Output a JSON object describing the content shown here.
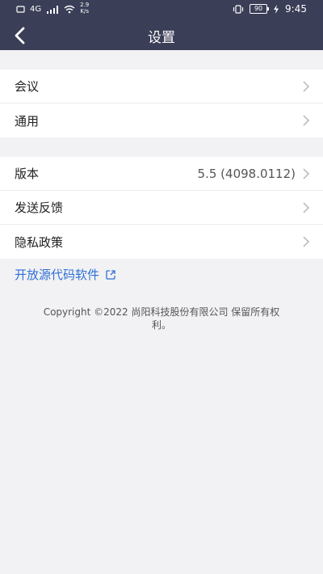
{
  "status_bar": {
    "network_label": "4G",
    "speed_top": "2.9",
    "speed_bottom": "K/s",
    "battery": "90",
    "time": "9:45"
  },
  "header": {
    "title": "设置"
  },
  "groups": [
    {
      "items": [
        {
          "label": "会议",
          "value": ""
        },
        {
          "label": "通用",
          "value": ""
        }
      ]
    },
    {
      "items": [
        {
          "label": "版本",
          "value": "5.5 (4098.0112)"
        },
        {
          "label": "发送反馈",
          "value": ""
        },
        {
          "label": "隐私政策",
          "value": ""
        }
      ]
    }
  ],
  "link": {
    "open_source": "开放源代码软件"
  },
  "footer": {
    "copyright_line1": "Copyright ©2022 尚阳科技股份有限公司 保留所有权",
    "copyright_line2": "利。"
  },
  "colors": {
    "header": "#3b3e57",
    "background": "#f2f2f4",
    "link": "#2f6fd8"
  }
}
